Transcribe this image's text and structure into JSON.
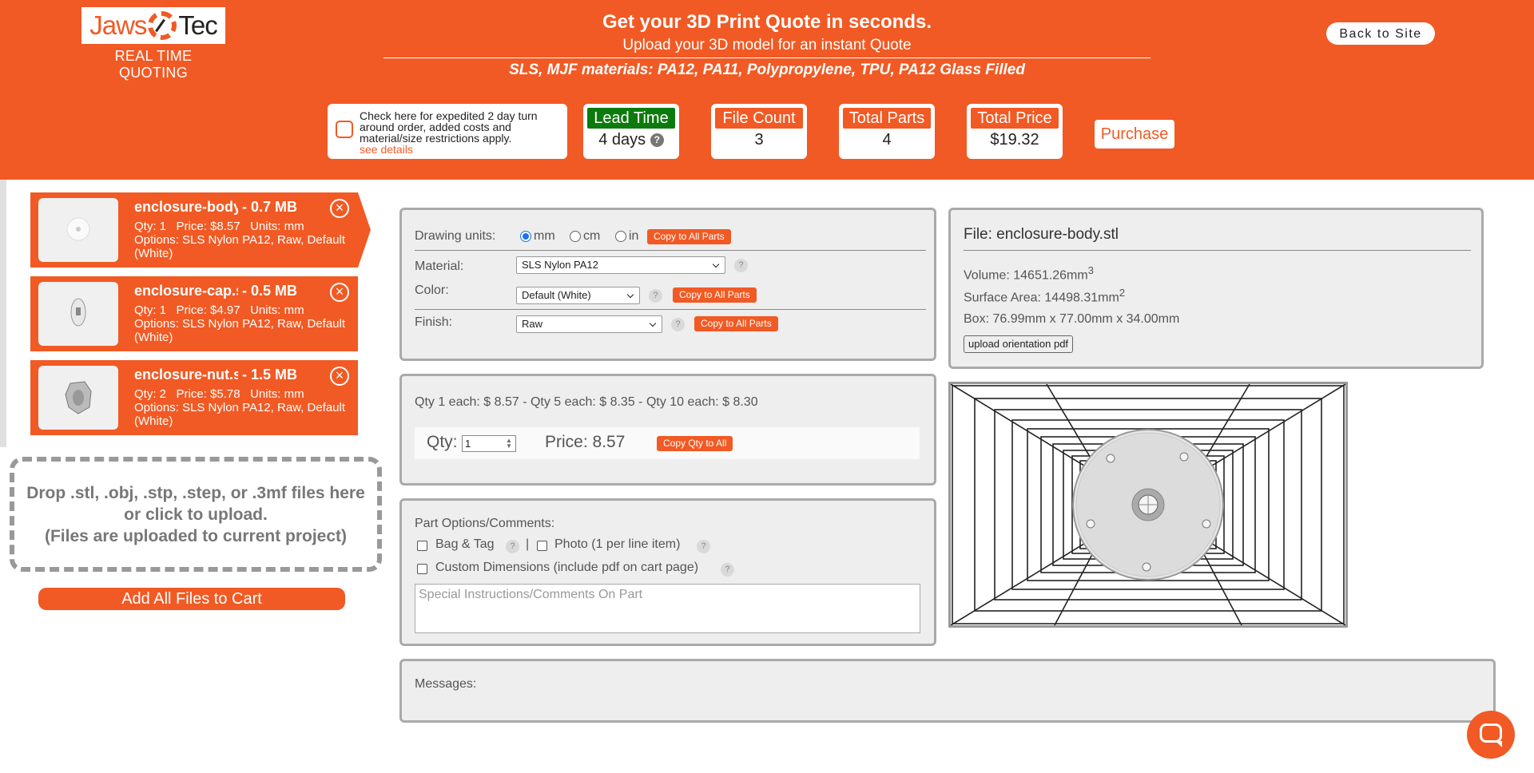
{
  "header": {
    "logo_text_left": "Jaws",
    "logo_text_right": "Tec",
    "tagline": "REAL TIME QUOTING",
    "headline": "Get your 3D Print Quote in seconds.",
    "subline": "Upload your 3D model for an instant Quote",
    "materials": "SLS, MJF materials: PA12, PA11, Polypropylene, TPU, PA12 Glass Filled",
    "back_label": "Back to Site",
    "expedite_text": "Check here for expedited 2 day turn around order, added costs and material/size restrictions apply.",
    "expedite_link": "see details",
    "lead_time_label": "Lead Time",
    "lead_time_value": "4 days",
    "file_count_label": "File Count",
    "file_count_value": "3",
    "total_parts_label": "Total Parts",
    "total_parts_value": "4",
    "total_price_label": "Total Price",
    "total_price_value": "$19.32",
    "purchase_label": "Purchase",
    "help_glyph": "?",
    "accent_color": "#f15a24",
    "lead_color": "#0d7a0d"
  },
  "files": [
    {
      "name": "enclosure-body.stl",
      "size": "- 0.7 MB",
      "qty": "Qty: 1",
      "price": "Price: $8.57",
      "units": "Units: mm",
      "options": "Options: SLS Nylon PA12, Raw, Default (White)"
    },
    {
      "name": "enclosure-cap.stl",
      "size": "- 0.5 MB",
      "qty": "Qty: 1",
      "price": "Price: $4.97",
      "units": "Units: mm",
      "options": "Options: SLS Nylon PA12, Raw, Default (White)"
    },
    {
      "name": "enclosure-nut.stl",
      "size": "- 1.5 MB",
      "qty": "Qty: 2",
      "price": "Price: $5.78",
      "units": "Units: mm",
      "options": "Options: SLS Nylon PA12, Raw, Default (White)"
    }
  ],
  "close_glyph": "×",
  "dropzone": {
    "line1": "Drop .stl, .obj, .stp, .step, or .3mf files here or click to upload.",
    "line2": "(Files are uploaded to current project)"
  },
  "add_all_label": "Add All Files to Cart",
  "settings": {
    "units_label": "Drawing units:",
    "unit_mm": "mm",
    "unit_cm": "cm",
    "unit_in": "in",
    "copy_all": "Copy to All Parts",
    "material_label": "Material:",
    "material_value": "SLS Nylon PA12",
    "color_label": "Color:",
    "color_value": "Default (White)",
    "finish_label": "Finish:",
    "finish_value": "Raw"
  },
  "pricing": {
    "breaks": "Qty 1 each: $ 8.57 - Qty 5 each: $ 8.35 - Qty 10 each: $ 8.30",
    "qty_label": "Qty:",
    "qty_value": "1",
    "price_label": "Price: 8.57",
    "copy_qty": "Copy Qty to All"
  },
  "options": {
    "title": "Part Options/Comments:",
    "bag_tag": "Bag & Tag",
    "separator": "|",
    "photo": "Photo (1 per line item)",
    "custom_dims": "Custom Dimensions (include pdf on cart page)",
    "comments_placeholder": "Special Instructions/Comments On Part"
  },
  "file_info": {
    "title": "File: enclosure-body.stl",
    "volume": "Volume:  14651.26mm",
    "volume_sup": "3",
    "surface": "Surface Area:  14498.31mm",
    "surface_sup": "2",
    "box": "Box:  76.99mm x 77.00mm x 34.00mm",
    "upload_pdf": "upload orientation pdf"
  },
  "messages_label": "Messages:"
}
